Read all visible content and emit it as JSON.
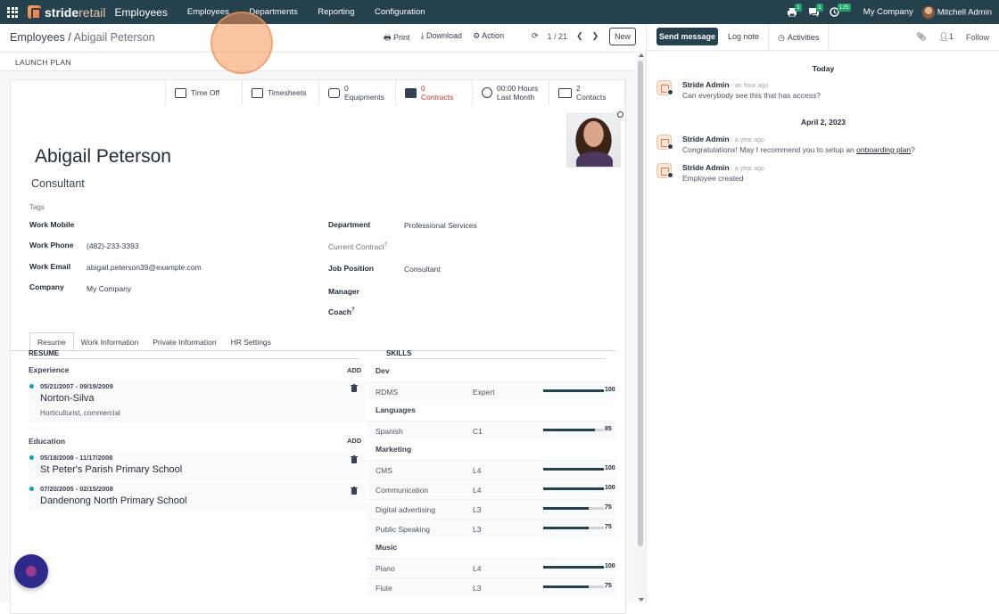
{
  "topbar": {
    "brand_bold": "stride",
    "brand_light": "retail",
    "module": "Employees",
    "nav": [
      "Employees",
      "Departments",
      "Reporting",
      "Configuration"
    ],
    "badges": {
      "print": "1",
      "chat": "1",
      "activity": "125"
    },
    "company": "My Company",
    "user": "Mitchell Admin"
  },
  "control": {
    "breadcrumb_parent": "Employees",
    "breadcrumb_sep": "/",
    "breadcrumb_current": "Abigail Peterson",
    "print": "Print",
    "download": "Download",
    "action": "Action",
    "pager": "1 / 21",
    "new": "New"
  },
  "statusbar": {
    "launch_plan": "LAUNCH PLAN"
  },
  "smart_buttons": {
    "time_off": "Time Off",
    "timesheets": "Timesheets",
    "equip_count": "0",
    "equip_label": "Equipments",
    "contracts_count": "0",
    "contracts_label": "Contracts",
    "hours_value": "00:00 Hours",
    "hours_label": "Last Month",
    "contacts_count": "2",
    "contacts_label": "Contacts"
  },
  "employee": {
    "name": "Abigail Peterson",
    "job_title": "Consultant",
    "tags_placeholder": "Tags"
  },
  "fields": {
    "work_mobile_label": "Work Mobile",
    "work_phone_label": "Work Phone",
    "work_phone": "(482)-233-3393",
    "work_email_label": "Work Email",
    "work_email": "abigail.peterson39@example.com",
    "company_label": "Company",
    "company": "My Company",
    "department_label": "Department",
    "department": "Professional Services",
    "contract_label": "Current Contract",
    "job_position_label": "Job Position",
    "job_position": "Consultant",
    "manager_label": "Manager",
    "coach_label": "Coach",
    "help": "?"
  },
  "tabs": [
    "Resume",
    "Work Information",
    "Private Information",
    "HR Settings"
  ],
  "resume": {
    "header": "RESUME",
    "add": "ADD",
    "experience_label": "Experience",
    "education_label": "Education",
    "experience": [
      {
        "dates": "05/21/2007 - 09/19/2009",
        "title": "Norton-Silva",
        "desc": "Horticulturist, commercial"
      }
    ],
    "education": [
      {
        "dates": "05/18/2008 - 11/17/2008",
        "title": "St Peter's Parish Primary School"
      },
      {
        "dates": "07/20/2005 - 02/15/2008",
        "title": "Dandenong North Primary School"
      }
    ]
  },
  "skills": {
    "header": "SKILLS",
    "groups": [
      {
        "name": "Dev",
        "items": [
          {
            "name": "RDMS",
            "level": "Expert",
            "progress": 100,
            "label": "100"
          }
        ]
      },
      {
        "name": "Languages",
        "items": [
          {
            "name": "Spanish",
            "level": "C1",
            "progress": 85,
            "label": "85"
          }
        ]
      },
      {
        "name": "Marketing",
        "items": [
          {
            "name": "CMS",
            "level": "L4",
            "progress": 100,
            "label": "100"
          },
          {
            "name": "Communication",
            "level": "L4",
            "progress": 100,
            "label": "100"
          },
          {
            "name": "Digital advertising",
            "level": "L3",
            "progress": 75,
            "label": "75"
          },
          {
            "name": "Public Speaking",
            "level": "L3",
            "progress": 75,
            "label": "75"
          }
        ]
      },
      {
        "name": "Music",
        "items": [
          {
            "name": "Piano",
            "level": "L4",
            "progress": 100,
            "label": "100"
          },
          {
            "name": "Flute",
            "level": "L3",
            "progress": 75,
            "label": "75"
          }
        ]
      }
    ]
  },
  "chatter": {
    "send_message": "Send message",
    "log_note": "Log note",
    "activities": "Activities",
    "followers": "1",
    "follow": "Follow",
    "today": "Today",
    "date2": "April 2, 2023",
    "messages": [
      {
        "author": "Stride Admin",
        "time": "- an hour ago",
        "text": "Can everybody see this that has access?"
      },
      {
        "author": "Stride Admin",
        "time": "- a year ago",
        "text_before": "Congratulations! May I recommend you to setup an ",
        "link": "onboarding plan",
        "text_after": "?"
      },
      {
        "author": "Stride Admin",
        "time": "- a year ago",
        "text": "Employee created"
      }
    ]
  },
  "colors": {
    "topbar": "#25414e",
    "accent_teal": "#14a0b4",
    "contracts_red": "#c43b2e",
    "brand_orange": "#e8744a"
  }
}
